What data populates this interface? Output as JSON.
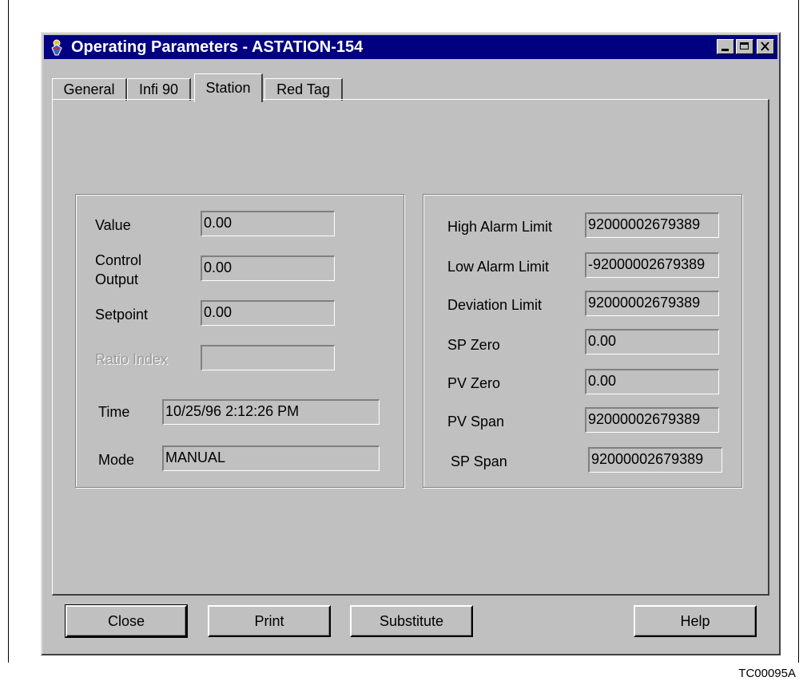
{
  "window": {
    "title": "Operating Parameters - ASTATION-154"
  },
  "tabs": [
    "General",
    "Infi 90",
    "Station",
    "Red Tag"
  ],
  "active_tab": "Station",
  "left_group": {
    "value_label": "Value",
    "value": "0.00",
    "control_output_label_1": "Control",
    "control_output_label_2": "Output",
    "control_output": "0.00",
    "setpoint_label": "Setpoint",
    "setpoint": "0.00",
    "ratio_index_label": "Ratio Index",
    "ratio_index": "",
    "time_label": "Time",
    "time": "10/25/96 2:12:26 PM",
    "mode_label": "Mode",
    "mode": "MANUAL"
  },
  "right_group": {
    "high_alarm_label": "High Alarm Limit",
    "high_alarm": "92000002679389",
    "low_alarm_label": "Low Alarm Limit",
    "low_alarm": "-92000002679389",
    "deviation_label": "Deviation Limit",
    "deviation": "92000002679389",
    "sp_zero_label": "SP Zero",
    "sp_zero": "0.00",
    "pv_zero_label": "PV Zero",
    "pv_zero": "0.00",
    "pv_span_label": "PV Span",
    "pv_span": "92000002679389",
    "sp_span_label": "SP Span",
    "sp_span": "92000002679389"
  },
  "buttons": {
    "close": "Close",
    "print": "Print",
    "substitute": "Substitute",
    "help": "Help"
  },
  "figure_code": "TC00095A",
  "icons": {
    "app": "app-icon",
    "minimize": "minimize-icon",
    "maximize": "maximize-icon",
    "close": "close-icon"
  },
  "colors": {
    "titlebar": "#000080",
    "face": "#c0c0c0"
  }
}
